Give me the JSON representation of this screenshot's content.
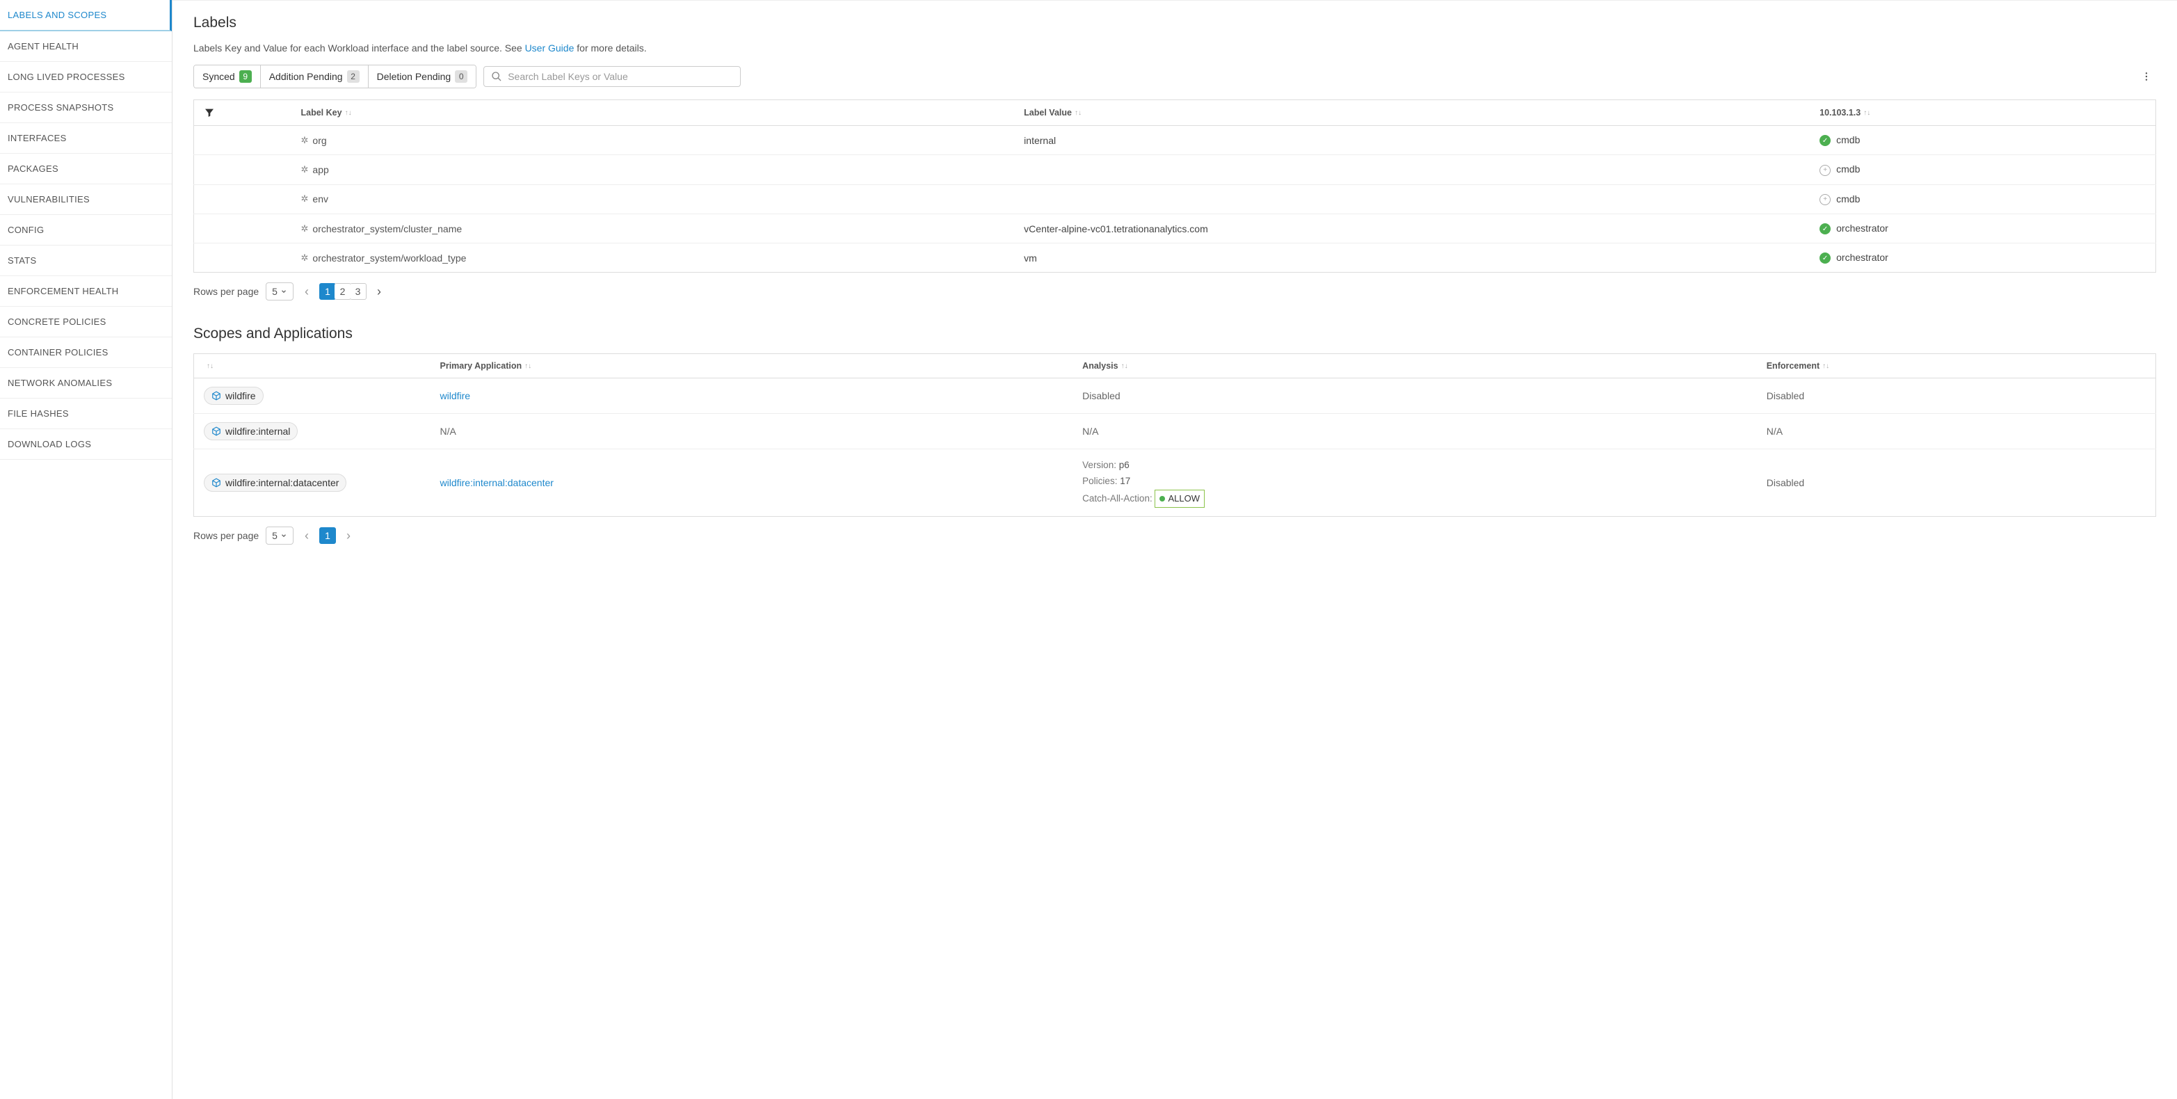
{
  "sidebar": {
    "items": [
      {
        "label": "LABELS AND SCOPES",
        "active": true
      },
      {
        "label": "AGENT HEALTH"
      },
      {
        "label": "LONG LIVED PROCESSES"
      },
      {
        "label": "PROCESS SNAPSHOTS"
      },
      {
        "label": "INTERFACES"
      },
      {
        "label": "PACKAGES"
      },
      {
        "label": "VULNERABILITIES"
      },
      {
        "label": "CONFIG"
      },
      {
        "label": "STATS"
      },
      {
        "label": "ENFORCEMENT HEALTH"
      },
      {
        "label": "CONCRETE POLICIES"
      },
      {
        "label": "CONTAINER POLICIES"
      },
      {
        "label": "NETWORK ANOMALIES"
      },
      {
        "label": "FILE HASHES"
      },
      {
        "label": "DOWNLOAD LOGS"
      }
    ]
  },
  "labels_section": {
    "title": "Labels",
    "desc_prefix": "Labels Key and Value for each Workload interface and the label source. See ",
    "desc_link": "User Guide",
    "desc_suffix": " for more details.",
    "filters": {
      "synced": {
        "label": "Synced",
        "count": "9"
      },
      "pending": {
        "label": "Addition Pending",
        "count": "2"
      },
      "deletion": {
        "label": "Deletion Pending",
        "count": "0"
      }
    },
    "search_placeholder": "Search Label Keys or Value",
    "columns": {
      "key": "Label Key",
      "value": "Label Value",
      "ip": "10.103.1.3"
    },
    "rows": [
      {
        "key": "org",
        "value": "internal",
        "src": "cmdb",
        "status": "check"
      },
      {
        "key": "app",
        "value": "",
        "src": "cmdb",
        "status": "plus"
      },
      {
        "key": "env",
        "value": "",
        "src": "cmdb",
        "status": "plus"
      },
      {
        "key": "orchestrator_system/cluster_name",
        "value": "vCenter-alpine-vc01.tetrationanalytics.com",
        "src": "orchestrator",
        "status": "check"
      },
      {
        "key": "orchestrator_system/workload_type",
        "value": "vm",
        "src": "orchestrator",
        "status": "check"
      }
    ],
    "pagination": {
      "rows_label": "Rows per page",
      "per_page": "5",
      "pages": [
        "1",
        "2",
        "3"
      ],
      "current": "1"
    }
  },
  "scopes_section": {
    "title": "Scopes and Applications",
    "columns": {
      "primary": "Primary Application",
      "analysis": "Analysis",
      "enforcement": "Enforcement"
    },
    "rows": [
      {
        "scope": "wildfire",
        "primary": "wildfire",
        "analysis": "Disabled",
        "enforcement": "Disabled",
        "type": "simple"
      },
      {
        "scope": "wildfire:internal",
        "primary": "N/A",
        "analysis": "N/A",
        "enforcement": "N/A",
        "type": "na"
      },
      {
        "scope": "wildfire:internal:datacenter",
        "primary": "wildfire:internal:datacenter",
        "analysis": {
          "version_label": "Version:",
          "version": "p6",
          "policies_label": "Policies:",
          "policies": "17",
          "catch_label": "Catch-All-Action:",
          "catch_value": "ALLOW"
        },
        "enforcement": "Disabled",
        "type": "detail"
      }
    ],
    "pagination": {
      "rows_label": "Rows per page",
      "per_page": "5",
      "pages": [
        "1"
      ],
      "current": "1"
    }
  }
}
